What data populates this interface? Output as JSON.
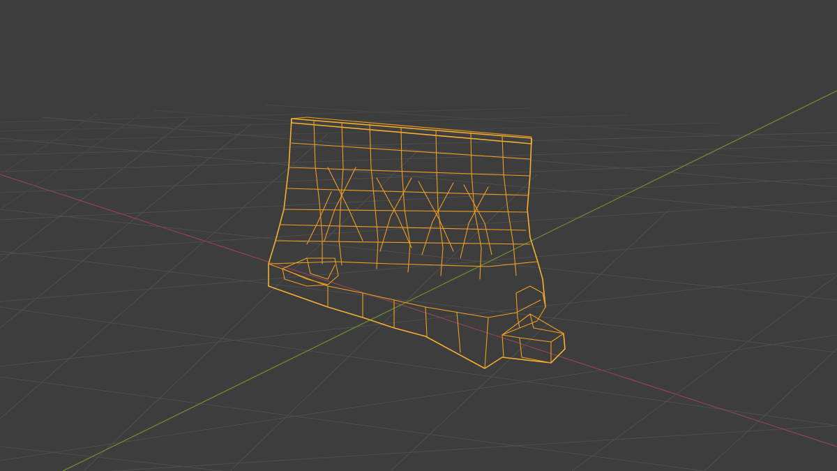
{
  "viewport": {
    "background_color": "#3d3d3d",
    "grid_color": "#4e4e4e",
    "x_axis_color": "#8a4450",
    "y_axis_color": "#6b8a2e"
  },
  "selected_object": {
    "kind": "concrete-jersey-barrier-mesh",
    "display_mode": "wireframe",
    "selected": true,
    "wire_color": "#f0a020"
  }
}
